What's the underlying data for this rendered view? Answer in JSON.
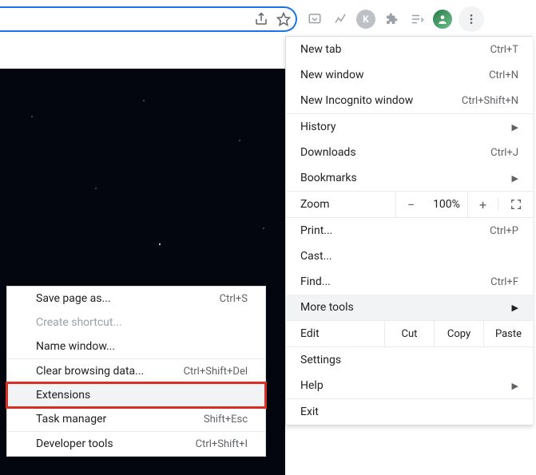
{
  "main_menu": {
    "new_tab": {
      "label": "New tab",
      "shortcut": "Ctrl+T"
    },
    "new_window": {
      "label": "New window",
      "shortcut": "Ctrl+N"
    },
    "new_incognito": {
      "label": "New Incognito window",
      "shortcut": "Ctrl+Shift+N"
    },
    "history": {
      "label": "History"
    },
    "downloads": {
      "label": "Downloads",
      "shortcut": "Ctrl+J"
    },
    "bookmarks": {
      "label": "Bookmarks"
    },
    "zoom": {
      "label": "Zoom",
      "minus": "−",
      "value": "100%",
      "plus": "+"
    },
    "print": {
      "label": "Print...",
      "shortcut": "Ctrl+P"
    },
    "cast": {
      "label": "Cast..."
    },
    "find": {
      "label": "Find...",
      "shortcut": "Ctrl+F"
    },
    "more_tools": {
      "label": "More tools"
    },
    "edit": {
      "label": "Edit",
      "cut": "Cut",
      "copy": "Copy",
      "paste": "Paste"
    },
    "settings": {
      "label": "Settings"
    },
    "help": {
      "label": "Help"
    },
    "exit": {
      "label": "Exit"
    }
  },
  "sub_menu": {
    "save_page": {
      "label": "Save page as...",
      "shortcut": "Ctrl+S"
    },
    "create_shortcut": {
      "label": "Create shortcut..."
    },
    "name_window": {
      "label": "Name window..."
    },
    "clear_data": {
      "label": "Clear browsing data...",
      "shortcut": "Ctrl+Shift+Del"
    },
    "extensions": {
      "label": "Extensions"
    },
    "task_manager": {
      "label": "Task manager",
      "shortcut": "Shift+Esc"
    },
    "dev_tools": {
      "label": "Developer tools",
      "shortcut": "Ctrl+Shift+I"
    }
  }
}
